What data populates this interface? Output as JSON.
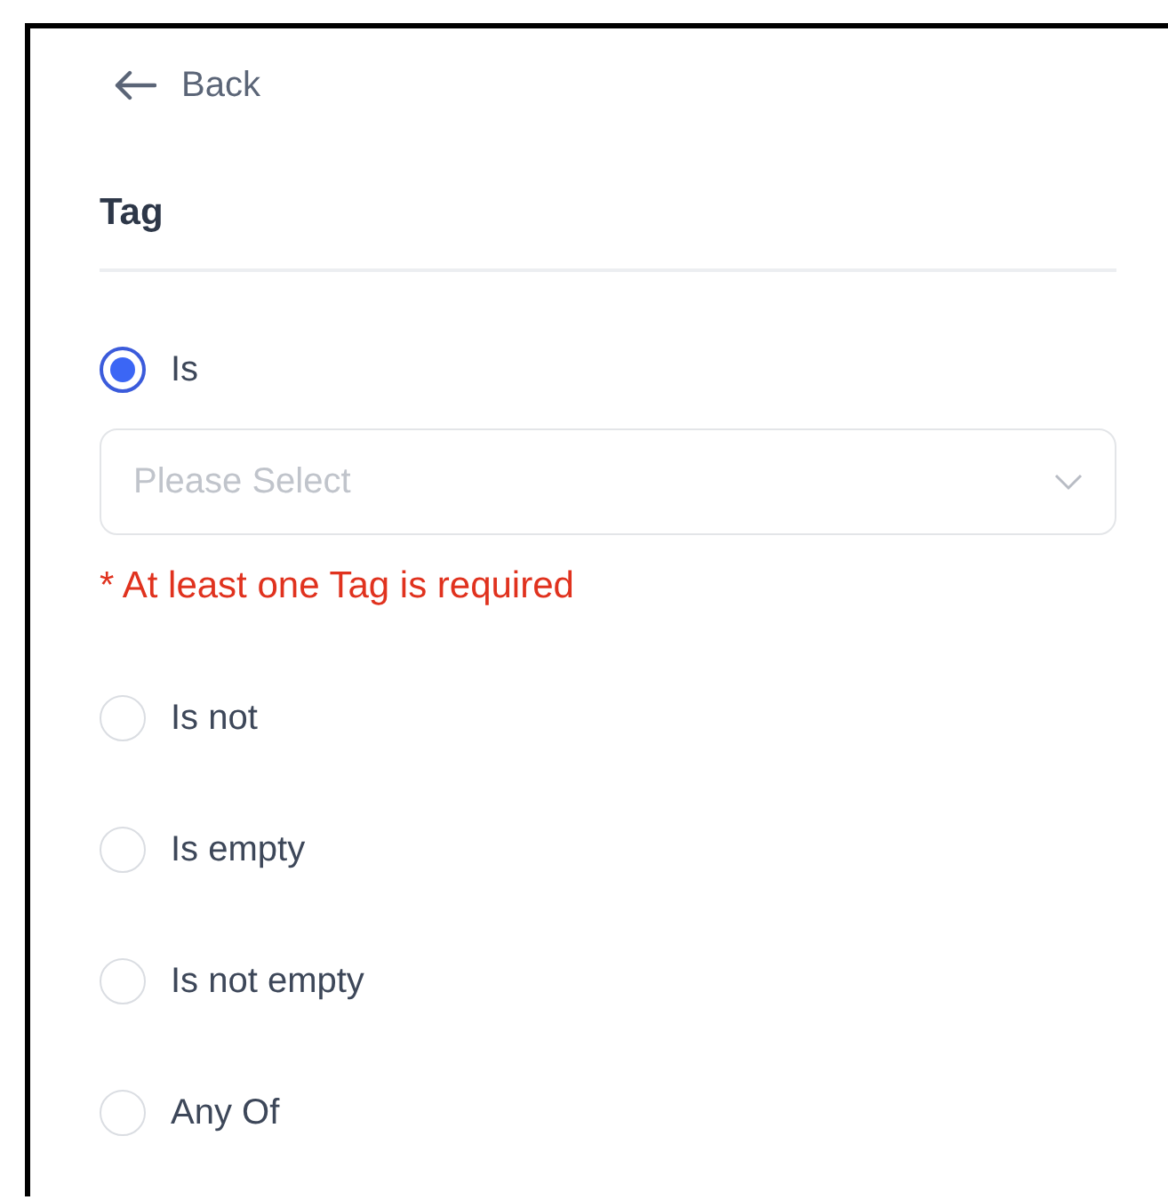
{
  "back": {
    "label": "Back"
  },
  "title": "Tag",
  "options": [
    {
      "label": "Is",
      "selected": true,
      "select": {
        "placeholder": "Please Select"
      },
      "error": "* At least one Tag is required"
    },
    {
      "label": "Is not",
      "selected": false
    },
    {
      "label": "Is empty",
      "selected": false
    },
    {
      "label": "Is not empty",
      "selected": false
    },
    {
      "label": "Any Of",
      "selected": false
    }
  ]
}
